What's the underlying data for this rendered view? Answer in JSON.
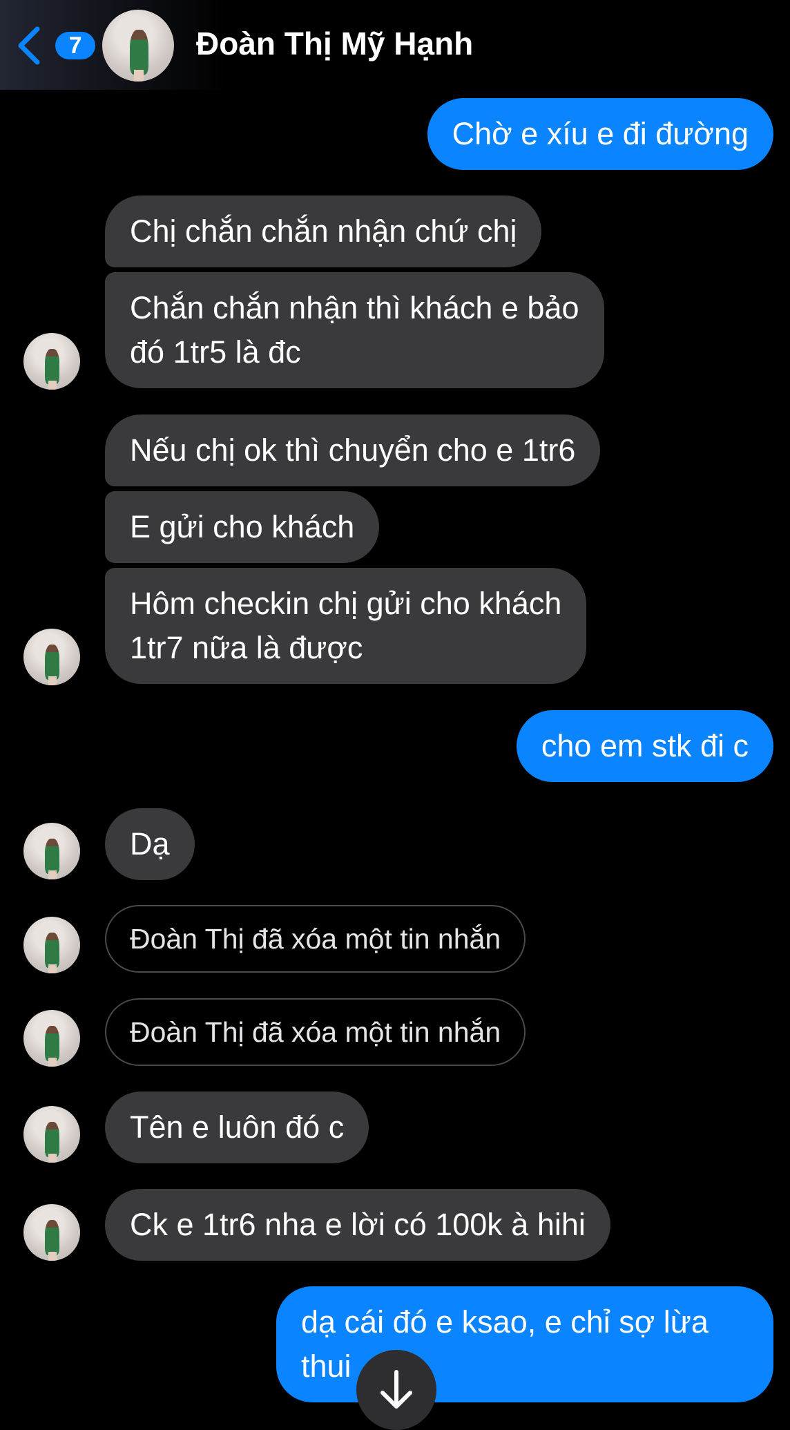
{
  "header": {
    "unread_count": "7",
    "contact_name": "Đoàn Thị Mỹ Hạnh"
  },
  "messages": [
    {
      "id": "m1",
      "sender": "me",
      "text": "Chờ e xíu e đi đường"
    },
    {
      "id": "m2",
      "sender": "them",
      "text": "Chị chắn chắn nhận chứ chị"
    },
    {
      "id": "m3",
      "sender": "them",
      "line1": "Chắn chắn nhận thì khách e bảo",
      "line2": "đó 1tr5  là đc"
    },
    {
      "id": "m4",
      "sender": "them",
      "text": "Nếu chị ok thì chuyển cho e 1tr6"
    },
    {
      "id": "m5",
      "sender": "them",
      "text": "E gửi cho khách"
    },
    {
      "id": "m6",
      "sender": "them",
      "line1": "Hôm checkin chị gửi cho khách",
      "line2": "1tr7 nữa là được"
    },
    {
      "id": "m7",
      "sender": "me",
      "text": "cho em stk đi c"
    },
    {
      "id": "m8",
      "sender": "them",
      "text": "Dạ"
    },
    {
      "id": "m9",
      "sender": "them",
      "deleted": true,
      "text": "Đoàn Thị đã xóa một tin nhắn"
    },
    {
      "id": "m10",
      "sender": "them",
      "deleted": true,
      "text": "Đoàn Thị đã xóa một tin nhắn"
    },
    {
      "id": "m11",
      "sender": "them",
      "text": "Tên e luôn đó c"
    },
    {
      "id": "m12",
      "sender": "them",
      "text": "Ck e 1tr6 nha e lời có 100k à hihi"
    },
    {
      "id": "m13",
      "sender": "me",
      "line1": "dạ cái đó e ksao, e chỉ sợ lừa",
      "line2": "thui ."
    }
  ],
  "colors": {
    "sent": "#0a84ff",
    "received": "#3a3a3c",
    "background": "#000000"
  },
  "icons": {
    "back": "chevron-left-icon",
    "scroll": "arrow-down-icon"
  }
}
